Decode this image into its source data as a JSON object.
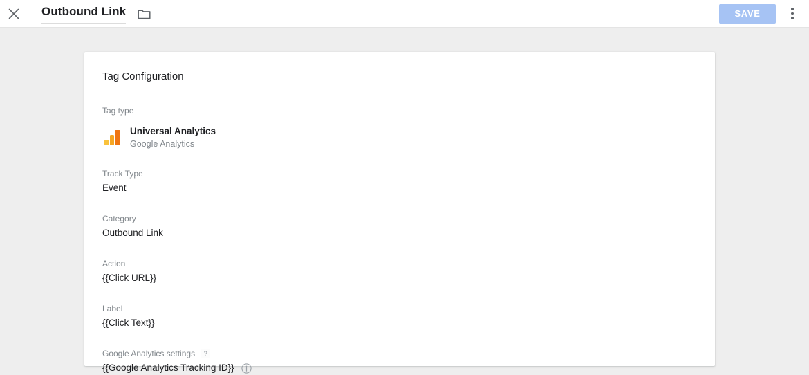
{
  "header": {
    "close_icon": "close-icon",
    "tag_name": "Outbound Link",
    "folder_icon": "folder-icon",
    "save_label": "SAVE",
    "save_color": "#a6c3f4",
    "menu_icon": "more-vert-icon"
  },
  "card": {
    "title": "Tag Configuration",
    "tag_type": {
      "label": "Tag type",
      "icon": "google-analytics-icon",
      "name": "Universal Analytics",
      "vendor": "Google Analytics"
    },
    "fields": [
      {
        "label": "Track Type",
        "value": "Event"
      },
      {
        "label": "Category",
        "value": "Outbound Link"
      },
      {
        "label": "Action",
        "value": "{{Click URL}}"
      },
      {
        "label": "Label",
        "value": "{{Click Text}}"
      }
    ],
    "ga_settings": {
      "label": "Google Analytics settings",
      "help_badge": "?",
      "value": "{{Google Analytics Tracking ID}}",
      "info_icon": "info-icon"
    }
  }
}
